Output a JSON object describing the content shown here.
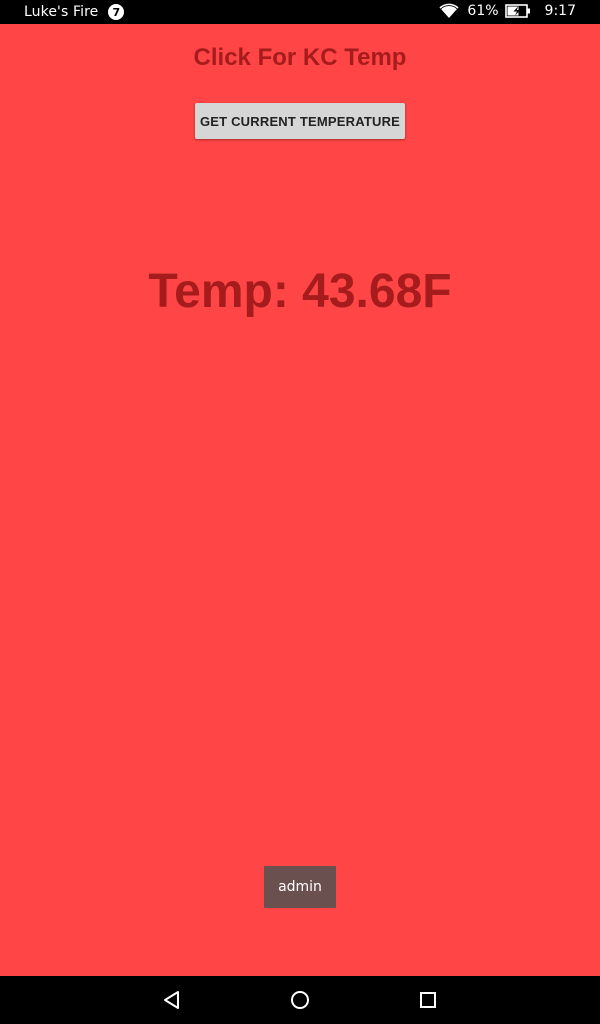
{
  "status_bar": {
    "device_name": "Luke's Fire",
    "notification_count": "7",
    "battery_percent": "61%",
    "time": "9:17",
    "icons": [
      "wifi-icon",
      "battery-charging-icon"
    ]
  },
  "app": {
    "title": "Click For KC Temp",
    "button_label": "GET CURRENT TEMPERATURE",
    "temperature_text": "Temp: 43.68F",
    "admin_label": "admin"
  },
  "nav_bar": {
    "icons": [
      "back-icon",
      "home-icon",
      "recents-icon"
    ]
  },
  "colors": {
    "background": "#ff4545",
    "title_text": "#a61c1c",
    "button_bg": "#d6d6d6",
    "admin_bg": "#6b5050"
  }
}
